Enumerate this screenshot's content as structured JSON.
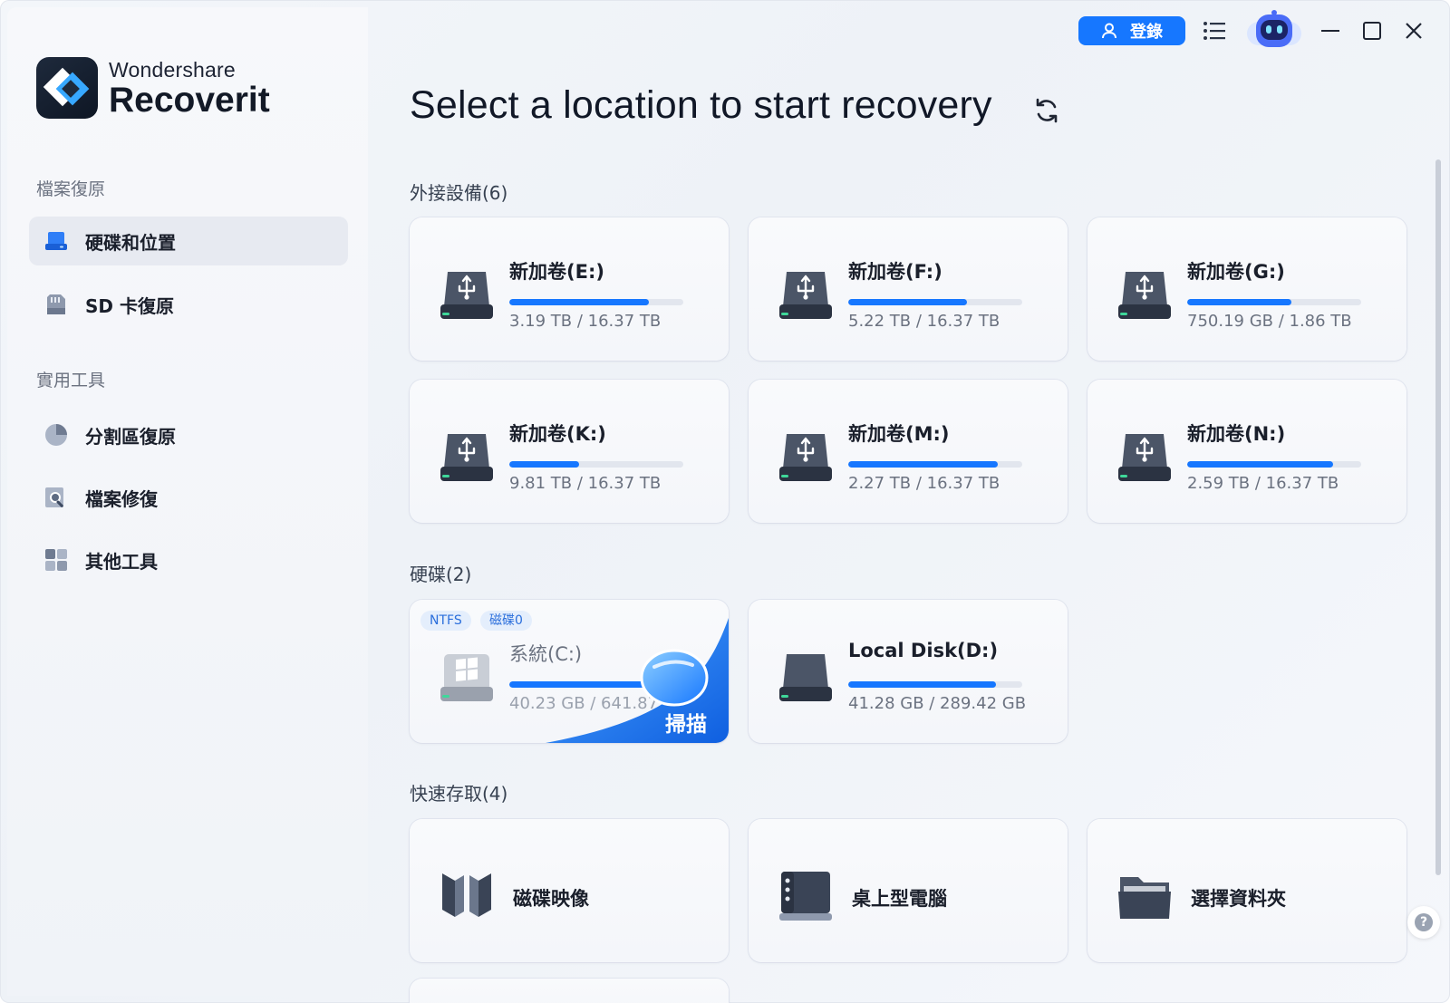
{
  "app": {
    "brand_top": "Wondershare",
    "brand_main": "Recoverit"
  },
  "sidebar": {
    "section1": "檔案復原",
    "items1": [
      {
        "label": "硬碟和位置",
        "icon": "drive-icon",
        "active": true
      },
      {
        "label": "SD 卡復原",
        "icon": "sd-card-icon",
        "active": false
      }
    ],
    "section2": "實用工具",
    "items2": [
      {
        "label": "分割區復原",
        "icon": "pie-chart-icon"
      },
      {
        "label": "檔案修復",
        "icon": "file-repair-icon"
      },
      {
        "label": "其他工具",
        "icon": "grid-tools-icon"
      }
    ]
  },
  "topbar": {
    "login_label": "登錄",
    "icons": [
      "user-icon",
      "list-menu-icon",
      "robot-assistant-icon",
      "minimize-icon",
      "maximize-icon",
      "close-icon"
    ]
  },
  "main": {
    "title": "Select a location to start recovery",
    "external_label": "外接設備(6)",
    "external": [
      {
        "name": "新加卷(E:)",
        "size": "3.19 TB / 16.37 TB",
        "fill": 0.8
      },
      {
        "name": "新加卷(F:)",
        "size": "5.22 TB / 16.37 TB",
        "fill": 0.68
      },
      {
        "name": "新加卷(G:)",
        "size": "750.19 GB / 1.86 TB",
        "fill": 0.6
      },
      {
        "name": "新加卷(K:)",
        "size": "9.81 TB / 16.37 TB",
        "fill": 0.4
      },
      {
        "name": "新加卷(M:)",
        "size": "2.27 TB / 16.37 TB",
        "fill": 0.86
      },
      {
        "name": "新加卷(N:)",
        "size": "2.59 TB / 16.37 TB",
        "fill": 0.84
      }
    ],
    "hdd_label": "硬碟(2)",
    "hdd": [
      {
        "name": "系統(C:)",
        "size": "40.23 GB / 641.87",
        "fill": 0.95,
        "tags": [
          "NTFS",
          "磁碟0"
        ],
        "scan_label": "掃描"
      },
      {
        "name": "Local Disk(D:)",
        "size": "41.28 GB / 289.42 GB",
        "fill": 0.85
      }
    ],
    "quick_label": "快速存取(4)",
    "quick": [
      {
        "name": "磁碟映像",
        "icon": "disk-image-icon"
      },
      {
        "name": "桌上型電腦",
        "icon": "desktop-icon"
      },
      {
        "name": "選擇資料夾",
        "icon": "folder-icon"
      }
    ],
    "help_label": "?"
  },
  "colors": {
    "accent": "#1677ff",
    "sidebar_active": "#e7eaf1"
  }
}
